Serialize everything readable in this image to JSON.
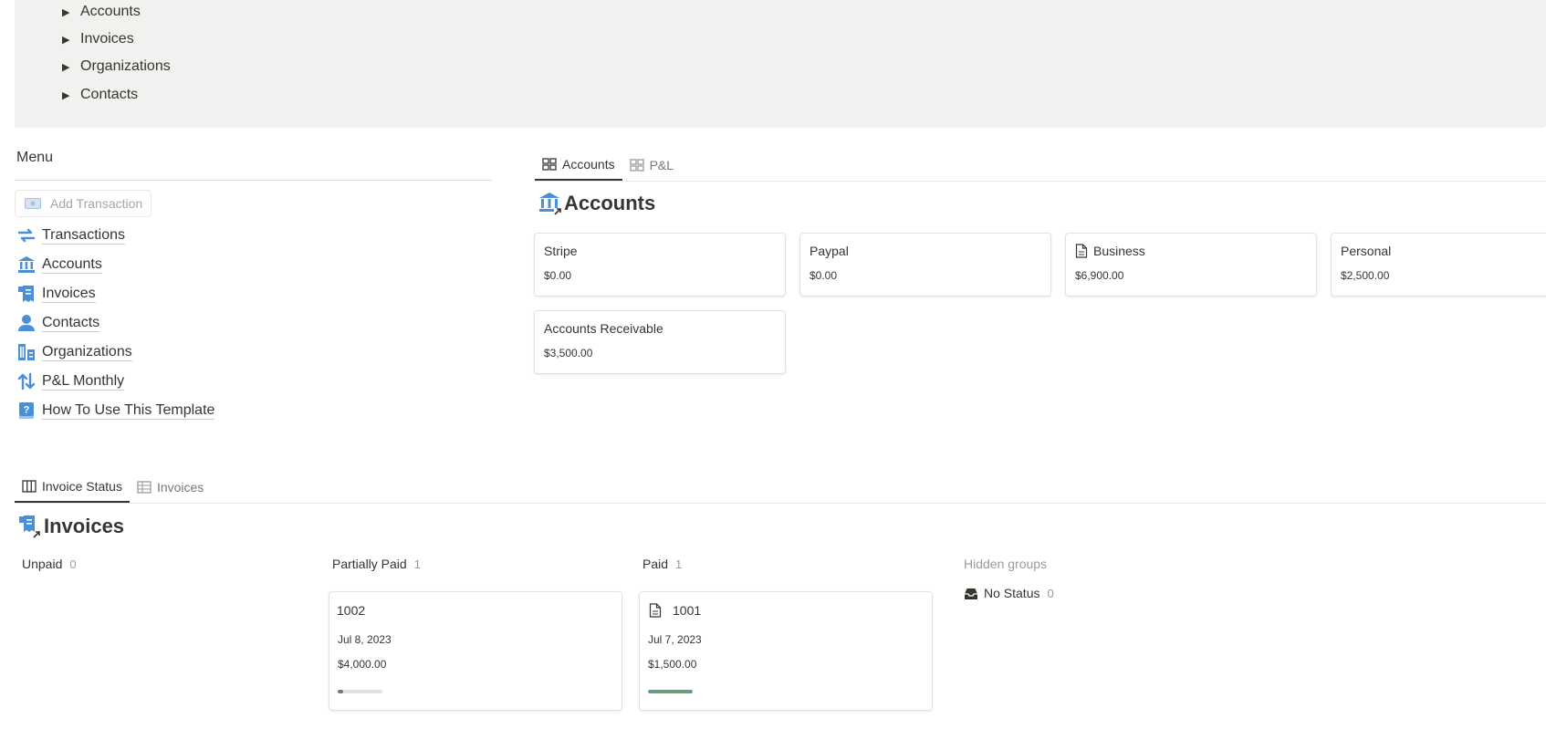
{
  "toggles": [
    "Accounts",
    "Invoices",
    "Organizations",
    "Contacts"
  ],
  "menu": {
    "title": "Menu",
    "add_transaction": "Add Transaction",
    "items": [
      {
        "label": "Transactions",
        "icon": "arrows-swap-icon"
      },
      {
        "label": "Accounts",
        "icon": "bank-icon"
      },
      {
        "label": "Invoices",
        "icon": "receipt-icon"
      },
      {
        "label": "Contacts",
        "icon": "person-icon"
      },
      {
        "label": "Organizations",
        "icon": "buildings-icon"
      },
      {
        "label": "P&L Monthly",
        "icon": "up-down-arrows-icon"
      },
      {
        "label": "How To Use This Template",
        "icon": "help-book-icon"
      }
    ]
  },
  "accounts_view": {
    "tabs": [
      {
        "label": "Accounts",
        "icon": "gallery-icon",
        "active": true
      },
      {
        "label": "P&L",
        "icon": "gallery-icon",
        "active": false
      }
    ],
    "title": "Accounts",
    "cards": [
      {
        "name": "Stripe",
        "amount": "$0.00"
      },
      {
        "name": "Paypal",
        "amount": "$0.00"
      },
      {
        "name": "Business",
        "amount": "$6,900.00",
        "icon": "document-icon"
      },
      {
        "name": "Personal",
        "amount": "$2,500.00"
      },
      {
        "name": "Accounts Receivable",
        "amount": "$3,500.00"
      }
    ]
  },
  "invoices_view": {
    "tabs": [
      {
        "label": "Invoice Status",
        "icon": "board-icon",
        "active": true
      },
      {
        "label": "Invoices",
        "icon": "table-icon",
        "active": false
      }
    ],
    "title": "Invoices",
    "groups": [
      {
        "name": "Unpaid",
        "count": "0"
      },
      {
        "name": "Partially Paid",
        "count": "1"
      },
      {
        "name": "Paid",
        "count": "1"
      }
    ],
    "hidden_groups_label": "Hidden groups",
    "hidden_group": {
      "name": "No Status",
      "count": "0",
      "icon": "inbox-icon"
    },
    "cards": [
      {
        "number": "1002",
        "date": "Jul 8, 2023",
        "amount": "$4,000.00",
        "progress": 0.12,
        "bar_color": "#787774"
      },
      {
        "number": "1001",
        "date": "Jul 7, 2023",
        "amount": "$1,500.00",
        "progress": 1.0,
        "bar_color": "#6c9b7d",
        "icon": "document-icon"
      }
    ]
  },
  "colors": {
    "accent_icon": "#4a8fd8",
    "panel_bg": "#f1f1ef",
    "text": "#37352f",
    "muted": "#9b9a97"
  }
}
